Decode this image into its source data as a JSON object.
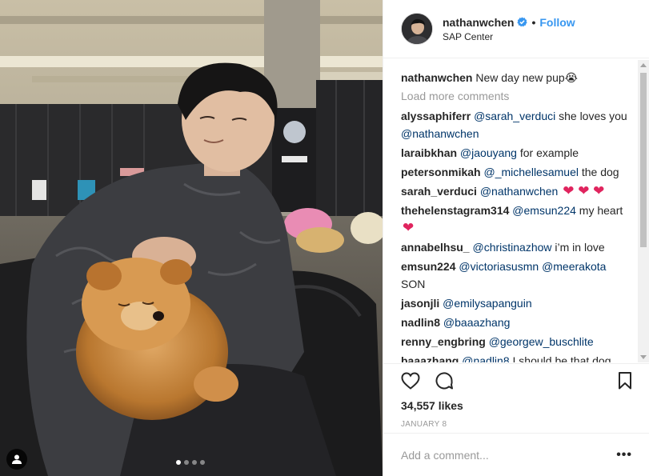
{
  "post": {
    "username": "nathanwchen",
    "location": "SAP Center",
    "follow_label": "Follow",
    "separator": "•",
    "caption": {
      "user": "nathanwchen",
      "text": "New day new pup",
      "emoji": "😭"
    },
    "load_more": "Load more comments",
    "likes": "34,557 likes",
    "date": "JANUARY 8",
    "add_comment_placeholder": "Add a comment...",
    "more_label": "•••",
    "carousel": {
      "count": 4,
      "active_index": 0
    }
  },
  "comments": [
    {
      "user": "alyssaphiferr",
      "mention": "@sarah_verduci",
      "text": "she loves you",
      "mention2": "@nathanwchen"
    },
    {
      "user": "laraibkhan",
      "mention": "@jaouyang",
      "text": "for example"
    },
    {
      "user": "petersonmikah",
      "mention": "@_michellesamuel",
      "text": "the dog"
    },
    {
      "user": "sarah_verduci",
      "mention": "@nathanwchen",
      "hearts": "❤ ❤ ❤"
    },
    {
      "user": "thehelenstagram314",
      "mention": "@emsun224",
      "text": "my heart",
      "hearts": "❤"
    },
    {
      "user": "annabelhsu_",
      "mention": "@christinazhow",
      "text": "i’m in love"
    },
    {
      "user": "emsun224",
      "mention": "@victoriasusmn",
      "mention2": "@meerakota",
      "text2": "SON"
    },
    {
      "user": "jasonjli",
      "mention": "@emilysapanguin"
    },
    {
      "user": "nadlin8",
      "mention": "@baaazhang"
    },
    {
      "user": "renny_engbring",
      "mention": "@georgew_buschlite"
    },
    {
      "user": "baaazhang",
      "mention": "@nadlin8",
      "text": "I should be that dog"
    }
  ],
  "colors": {
    "link": "#3897f0",
    "mention": "#003569",
    "muted": "#999999",
    "heart": "#e0245e",
    "verified": "#3897f0"
  },
  "icons": {
    "verified": "verified-badge-icon",
    "like": "heart-outline-icon",
    "comment": "comment-bubble-icon",
    "save": "bookmark-icon",
    "tag": "user-tag-icon"
  }
}
